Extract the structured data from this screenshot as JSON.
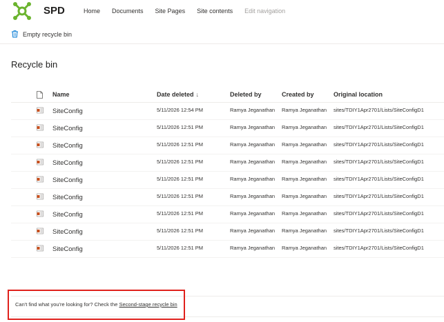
{
  "site": {
    "title": "SPD",
    "nav": [
      "Home",
      "Documents",
      "Site Pages",
      "Site contents"
    ],
    "edit_nav_label": "Edit navigation"
  },
  "commandbar": {
    "empty_label": "Empty recycle bin"
  },
  "page": {
    "title": "Recycle bin"
  },
  "table": {
    "columns": {
      "name": "Name",
      "date_deleted": "Date deleted",
      "sort_indicator": "↓",
      "deleted_by": "Deleted by",
      "created_by": "Created by",
      "original_location": "Original location"
    },
    "rows": [
      {
        "name": "SiteConfig",
        "date": "5/11/2026 12:54 PM",
        "deleted_by": "Ramya Jeganathan",
        "created_by": "Ramya Jeganathan",
        "location": "sites/TDIY1Apr2701/Lists/SiteConfigD1"
      },
      {
        "name": "SiteConfig",
        "date": "5/11/2026 12:51 PM",
        "deleted_by": "Ramya Jeganathan",
        "created_by": "Ramya Jeganathan",
        "location": "sites/TDIY1Apr2701/Lists/SiteConfigD1"
      },
      {
        "name": "SiteConfig",
        "date": "5/11/2026 12:51 PM",
        "deleted_by": "Ramya Jeganathan",
        "created_by": "Ramya Jeganathan",
        "location": "sites/TDIY1Apr2701/Lists/SiteConfigD1"
      },
      {
        "name": "SiteConfig",
        "date": "5/11/2026 12:51 PM",
        "deleted_by": "Ramya Jeganathan",
        "created_by": "Ramya Jeganathan",
        "location": "sites/TDIY1Apr2701/Lists/SiteConfigD1"
      },
      {
        "name": "SiteConfig",
        "date": "5/11/2026 12:51 PM",
        "deleted_by": "Ramya Jeganathan",
        "created_by": "Ramya Jeganathan",
        "location": "sites/TDIY1Apr2701/Lists/SiteConfigD1"
      },
      {
        "name": "SiteConfig",
        "date": "5/11/2026 12:51 PM",
        "deleted_by": "Ramya Jeganathan",
        "created_by": "Ramya Jeganathan",
        "location": "sites/TDIY1Apr2701/Lists/SiteConfigD1"
      },
      {
        "name": "SiteConfig",
        "date": "5/11/2026 12:51 PM",
        "deleted_by": "Ramya Jeganathan",
        "created_by": "Ramya Jeganathan",
        "location": "sites/TDIY1Apr2701/Lists/SiteConfigD1"
      },
      {
        "name": "SiteConfig",
        "date": "5/11/2026 12:51 PM",
        "deleted_by": "Ramya Jeganathan",
        "created_by": "Ramya Jeganathan",
        "location": "sites/TDIY1Apr2701/Lists/SiteConfigD1"
      },
      {
        "name": "SiteConfig",
        "date": "5/11/2026 12:51 PM",
        "deleted_by": "Ramya Jeganathan",
        "created_by": "Ramya Jeganathan",
        "location": "sites/TDIY1Apr2701/Lists/SiteConfigD1"
      }
    ]
  },
  "footer": {
    "prompt": "Can't find what you're looking for? Check the",
    "link": "Second-stage recycle bin"
  },
  "colors": {
    "logo": "#6bb42e",
    "highlight": "#e0201b",
    "list_icon": "#c8501e"
  },
  "icons": {
    "logo": "spd-logo-icon",
    "empty": "recycle-bin-icon",
    "header_file": "file-type-icon",
    "row": "list-item-icon"
  }
}
